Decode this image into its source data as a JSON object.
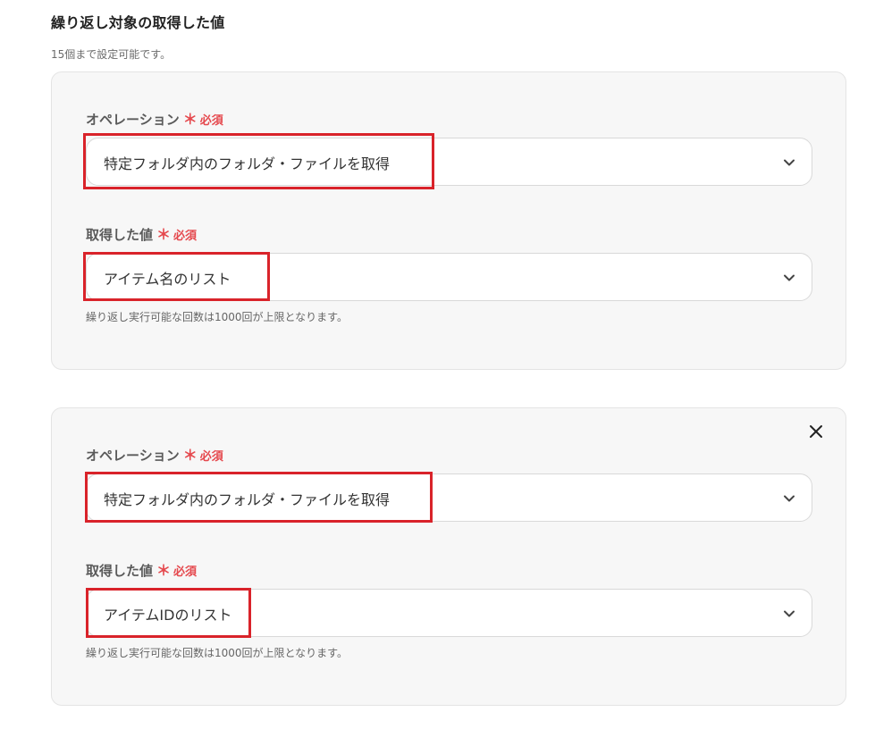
{
  "section": {
    "title": "繰り返し対象の取得した値",
    "subtitle": "15個まで設定可能です。"
  },
  "required_marker": "＊",
  "required_text": "必須",
  "cards": [
    {
      "operation_label": "オペレーション",
      "operation_value": "特定フォルダ内のフォルダ・ファイルを取得",
      "value_label": "取得した値",
      "value_value": "アイテム名のリスト",
      "hint": "繰り返し実行可能な回数は1000回が上限となります。",
      "has_close": false
    },
    {
      "operation_label": "オペレーション",
      "operation_value": "特定フォルダ内のフォルダ・ファイルを取得",
      "value_label": "取得した値",
      "value_value": "アイテムIDのリスト",
      "hint": "繰り返し実行可能な回数は1000回が上限となります。",
      "has_close": true
    }
  ],
  "icons": {
    "select_arrow": "chevron-down-icon",
    "remove": "close-icon"
  },
  "colors": {
    "required": "#e5484d",
    "highlight": "#d9232a",
    "card_bg": "#f7f7f7"
  }
}
